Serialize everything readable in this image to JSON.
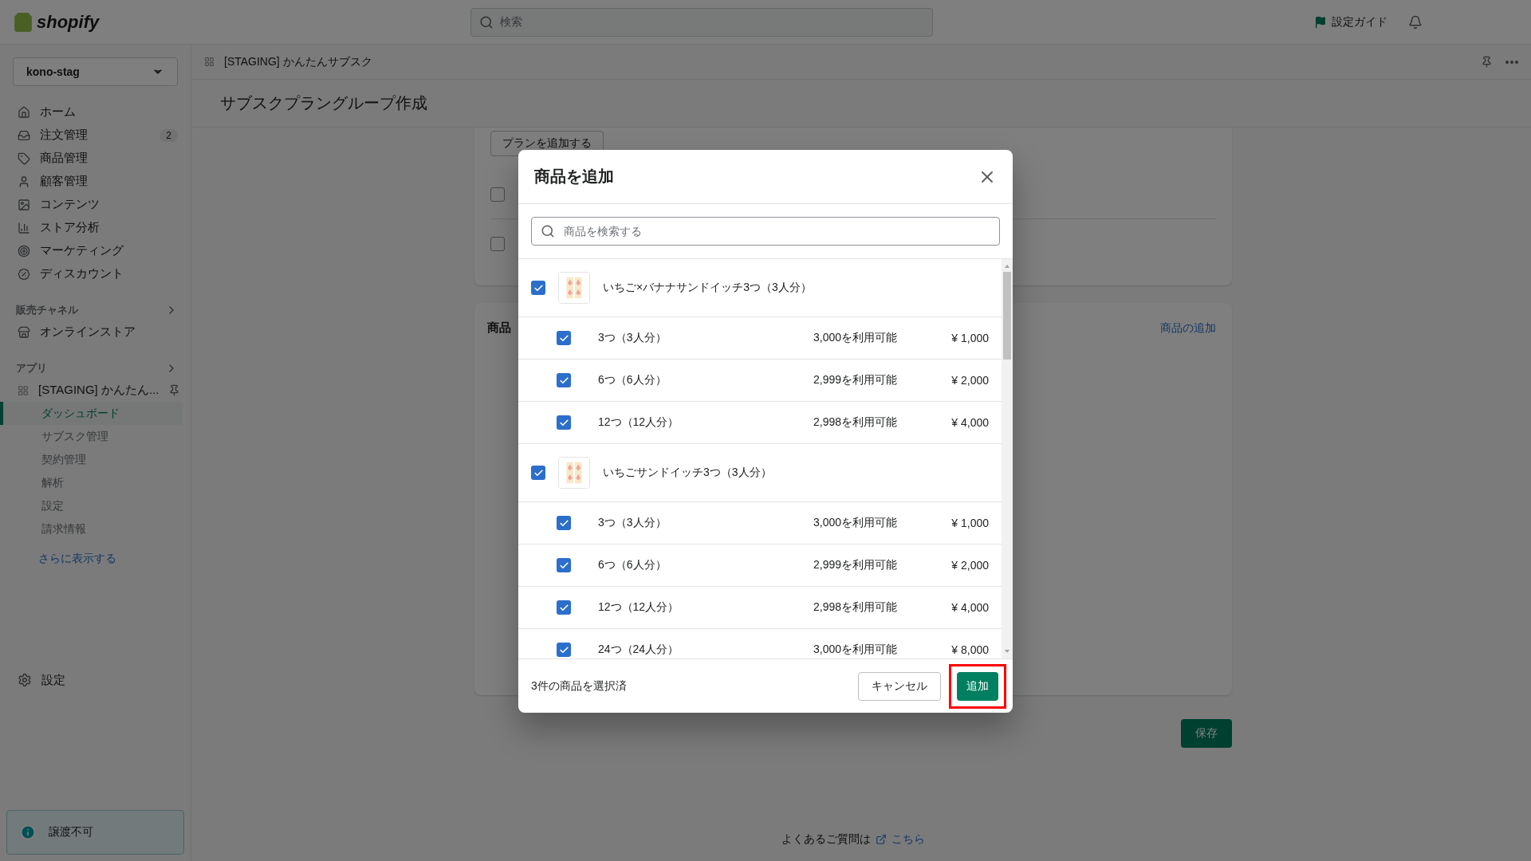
{
  "topbar": {
    "logo": "shopify",
    "search_placeholder": "検索",
    "guide": "設定ガイド"
  },
  "sidebar": {
    "store": "kono-stag",
    "nav": [
      {
        "label": "ホーム"
      },
      {
        "label": "注文管理",
        "badge": "2"
      },
      {
        "label": "商品管理"
      },
      {
        "label": "顧客管理"
      },
      {
        "label": "コンテンツ"
      },
      {
        "label": "ストア分析"
      },
      {
        "label": "マーケティング"
      },
      {
        "label": "ディスカウント"
      }
    ],
    "channels": {
      "heading": "販売チャネル",
      "items": [
        "オンラインストア"
      ]
    },
    "apps": {
      "heading": "アプリ",
      "app": "[STAGING] かんたん...",
      "children": [
        {
          "label": "ダッシュボード",
          "selected": true
        },
        {
          "label": "サブスク管理",
          "selected": false
        },
        {
          "label": "契約管理",
          "selected": false
        },
        {
          "label": "解析",
          "selected": false
        },
        {
          "label": "設定",
          "selected": false
        },
        {
          "label": "請求情報",
          "selected": false
        }
      ],
      "more": "さらに表示する"
    },
    "settings": "設定",
    "notice": "譲渡不可"
  },
  "breadcrumb": "[STAGING] かんたんサブスク",
  "page_title": "サブスクプラングループ作成",
  "plan_card": {
    "add_plan_button": "プランを追加する",
    "checkboxes": [
      {
        "checked": false
      },
      {
        "checked": false
      }
    ]
  },
  "product_card": {
    "title": "商品",
    "add_link": "商品の追加"
  },
  "save_button": "保存",
  "faq": {
    "text": "よくあるご質問は",
    "link": "こちら"
  },
  "modal": {
    "title": "商品を追加",
    "search_placeholder": "商品を検索する",
    "products": [
      {
        "name": "いちご×バナナサンドイッチ3つ（3人分）",
        "checked": true,
        "variants": [
          {
            "name": "3つ（3人分）",
            "stock": "3,000を利用可能",
            "price": "¥ 1,000",
            "checked": true
          },
          {
            "name": "6つ（6人分）",
            "stock": "2,999を利用可能",
            "price": "¥ 2,000",
            "checked": true
          },
          {
            "name": "12つ（12人分）",
            "stock": "2,998を利用可能",
            "price": "¥ 4,000",
            "checked": true
          }
        ]
      },
      {
        "name": "いちごサンドイッチ3つ（3人分）",
        "checked": true,
        "variants": [
          {
            "name": "3つ（3人分）",
            "stock": "3,000を利用可能",
            "price": "¥ 1,000",
            "checked": true
          },
          {
            "name": "6つ（6人分）",
            "stock": "2,999を利用可能",
            "price": "¥ 2,000",
            "checked": true
          },
          {
            "name": "12つ（12人分）",
            "stock": "2,998を利用可能",
            "price": "¥ 4,000",
            "checked": true
          },
          {
            "name": "24つ（24人分）",
            "stock": "3,000を利用可能",
            "price": "¥ 8,000",
            "checked": true
          }
        ]
      }
    ],
    "selected_count": "3件の商品を選択済",
    "cancel": "キャンセル",
    "add": {
      "label": "追加",
      "highlighted": true
    }
  }
}
